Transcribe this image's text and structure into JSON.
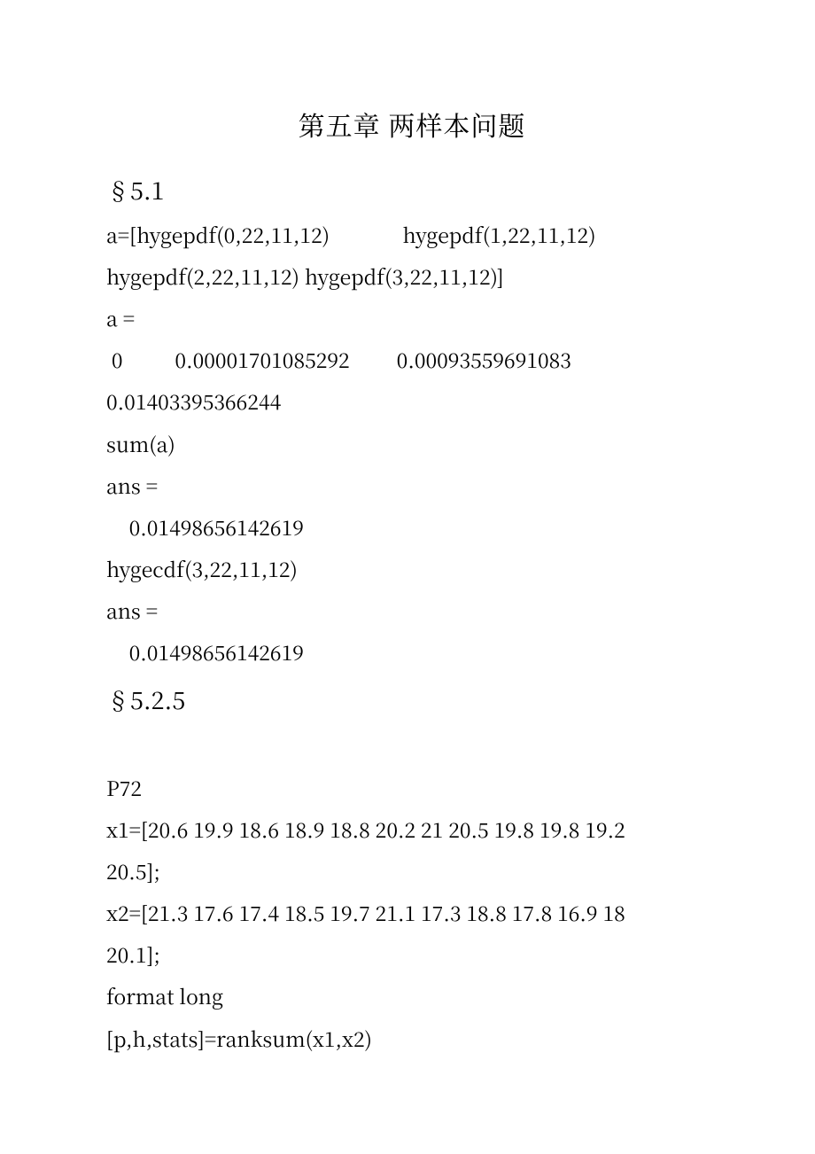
{
  "title": "第五章   两样本问题",
  "section1": "§5.1",
  "l1": "a=[hygepdf(0,22,11,12)              hygepdf(1,22,11,12)",
  "l2": "hygepdf(2,22,11,12) hygepdf(3,22,11,12)]",
  "l3": "a =",
  "l4": " 0          0.00001701085292         0.00093559691083",
  "l5": "0.01403395366244",
  "l6": "sum(a)",
  "l7": "ans =",
  "l8": "0.01498656142619",
  "l9": "hygecdf(3,22,11,12)",
  "l10": "ans =",
  "l11": "0.01498656142619",
  "section2": "§5.2.5",
  "l12": "P72",
  "l13": "x1=[20.6 19.9 18.6 18.9 18.8 20.2 21 20.5 19.8 19.8 19.2",
  "l14": "20.5];",
  "l15": "x2=[21.3 17.6 17.4 18.5 19.7 21.1 17.3 18.8 17.8 16.9 18",
  "l16": "20.1];",
  "l17": "format long",
  "l18": "[p,h,stats]=ranksum(x1,x2)"
}
